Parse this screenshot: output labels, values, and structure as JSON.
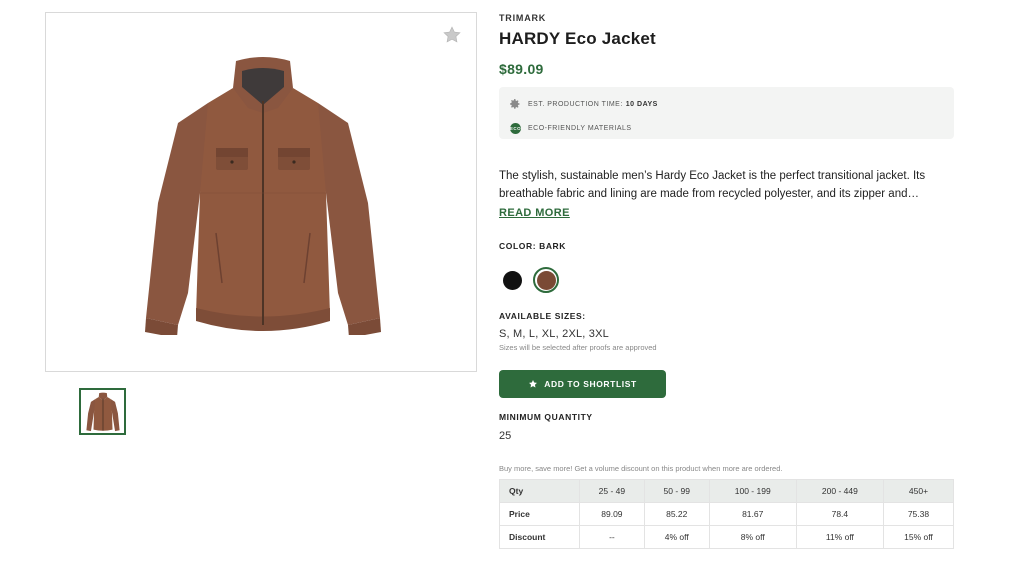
{
  "product": {
    "brand": "TRIMARK",
    "title": "HARDY Eco Jacket",
    "price": "$89.09",
    "features": {
      "production_label": "EST. PRODUCTION TIME:",
      "production_value": "10 DAYS",
      "eco_badge": "ECO",
      "eco_label": "ECO-FRIENDLY MATERIALS"
    },
    "description": "The stylish, sustainable men’s Hardy Eco Jacket is the perfect transitional jacket. Its breathable fabric and lining are made from recycled polyester, and its zipper and…",
    "read_more": "READ MORE",
    "color_label": "COLOR: BARK",
    "colors": [
      {
        "name": "Black",
        "hex": "#111111",
        "selected": false
      },
      {
        "name": "Bark",
        "hex": "#7a4a35",
        "selected": true
      }
    ],
    "sizes_label": "AVAILABLE SIZES:",
    "sizes": "S, M, L, XL, 2XL, 3XL",
    "sizes_note": "Sizes will be selected after proofs are approved",
    "shortlist_label": "ADD TO SHORTLIST",
    "min_qty_label": "MINIMUM QUANTITY",
    "min_qty": "25",
    "volume_note": "Buy more, save more! Get a volume discount on this product when more are ordered."
  },
  "pricing": {
    "headers": [
      "Qty",
      "25 - 49",
      "50 - 99",
      "100 - 199",
      "200 - 449",
      "450+"
    ],
    "rows": [
      [
        "Price",
        "89.09",
        "85.22",
        "81.67",
        "78.4",
        "75.38"
      ],
      [
        "Discount",
        "--",
        "4% off",
        "8% off",
        "11% off",
        "15% off"
      ]
    ]
  },
  "icons": {
    "favorite": "star-icon",
    "production": "gear-icon",
    "eco": "eco-leaf-icon",
    "shortlist": "star-icon"
  },
  "colors": {
    "accent": "#2e6b3c",
    "jacket": "#8a5640"
  }
}
